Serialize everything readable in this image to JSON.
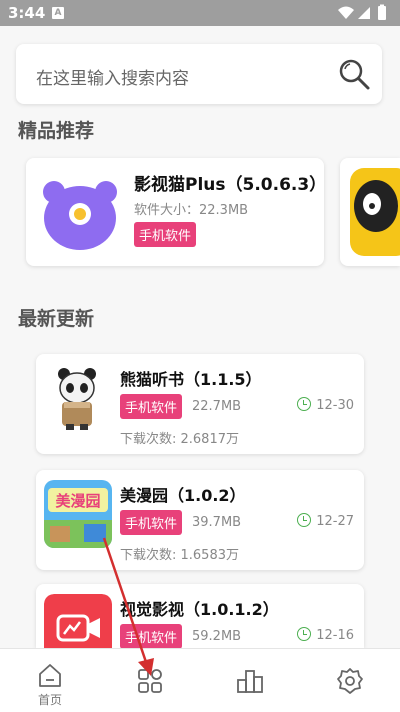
{
  "status_bar": {
    "time": "3:44",
    "notif_letter": "A"
  },
  "search": {
    "placeholder": "在这里输入搜索内容"
  },
  "sections": {
    "featured_title": "精品推荐",
    "latest_title": "最新更新"
  },
  "featured": [
    {
      "name": "影视猫Plus（5.0.6.3）",
      "size": "软件大小：22.3MB",
      "tag": "手机软件"
    }
  ],
  "latest": [
    {
      "name": "熊猫听书（1.1.5）",
      "tag": "手机软件",
      "size": "22.7MB",
      "date": "12-30",
      "downloads": "下载次数: 2.6817万"
    },
    {
      "name": "美漫园（1.0.2）",
      "tag": "手机软件",
      "size": "39.7MB",
      "date": "12-27",
      "downloads": "下载次数: 1.6583万",
      "icon_text": "美漫园"
    },
    {
      "name": "视觉影视（1.0.1.2）",
      "tag": "手机软件",
      "size": "59.2MB",
      "date": "12-16"
    }
  ],
  "nav": [
    {
      "label": "首页",
      "icon": "home-icon"
    },
    {
      "label": "",
      "icon": "apps-icon"
    },
    {
      "label": "",
      "icon": "ranking-icon"
    },
    {
      "label": "",
      "icon": "settings-icon"
    }
  ],
  "colors": {
    "tag": "#e8417a",
    "accent_green": "#4caf50",
    "status_bar": "#9e9e9e",
    "annotation_arrow": "#d32f2f"
  }
}
